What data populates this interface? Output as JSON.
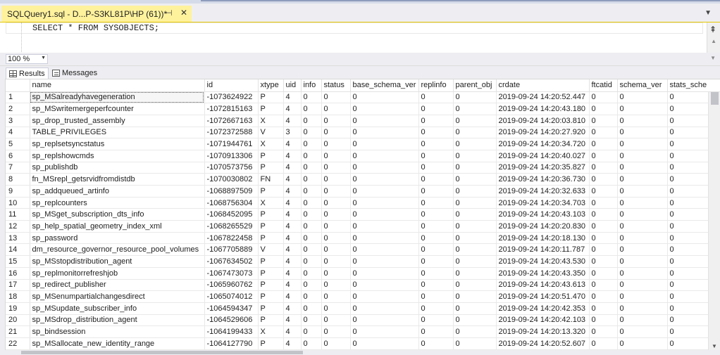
{
  "tab": {
    "title": "SQLQuery1.sql - D...P-S3KL81P\\HP (61))*",
    "pin_glyph": "⊣",
    "close_glyph": "✕",
    "dropdown_glyph": "▼"
  },
  "editor": {
    "code": "SELECT * FROM SYSOBJECTS;",
    "split_glyph": "⇞",
    "scroll_up_glyph": "▲"
  },
  "zoom": {
    "value": "100 %",
    "arrow_glyph": "▼",
    "scroll_down_glyph": "▼"
  },
  "result_tabs": {
    "results_label": "Results",
    "messages_label": "Messages"
  },
  "grid": {
    "columns": [
      "name",
      "id",
      "xtype",
      "uid",
      "info",
      "status",
      "base_schema_ver",
      "replinfo",
      "parent_obj",
      "crdate",
      "ftcatid",
      "schema_ver",
      "stats_sche"
    ],
    "rows": [
      [
        "1",
        "sp_MSalreadyhavegeneration",
        "-1073624922",
        "P",
        "4",
        "0",
        "0",
        "0",
        "0",
        "0",
        "2019-09-24 14:20:52.447",
        "0",
        "0",
        "0"
      ],
      [
        "2",
        "sp_MSwritemergeperfcounter",
        "-1072815163",
        "P",
        "4",
        "0",
        "0",
        "0",
        "0",
        "0",
        "2019-09-24 14:20:43.180",
        "0",
        "0",
        "0"
      ],
      [
        "3",
        "sp_drop_trusted_assembly",
        "-1072667163",
        "X",
        "4",
        "0",
        "0",
        "0",
        "0",
        "0",
        "2019-09-24 14:20:03.810",
        "0",
        "0",
        "0"
      ],
      [
        "4",
        "TABLE_PRIVILEGES",
        "-1072372588",
        "V",
        "3",
        "0",
        "0",
        "0",
        "0",
        "0",
        "2019-09-24 14:20:27.920",
        "0",
        "0",
        "0"
      ],
      [
        "5",
        "sp_replsetsyncstatus",
        "-1071944761",
        "X",
        "4",
        "0",
        "0",
        "0",
        "0",
        "0",
        "2019-09-24 14:20:34.720",
        "0",
        "0",
        "0"
      ],
      [
        "6",
        "sp_replshowcmds",
        "-1070913306",
        "P",
        "4",
        "0",
        "0",
        "0",
        "0",
        "0",
        "2019-09-24 14:20:40.027",
        "0",
        "0",
        "0"
      ],
      [
        "7",
        "sp_publishdb",
        "-1070573756",
        "P",
        "4",
        "0",
        "0",
        "0",
        "0",
        "0",
        "2019-09-24 14:20:35.827",
        "0",
        "0",
        "0"
      ],
      [
        "8",
        "fn_MSrepl_getsrvidfromdistdb",
        "-1070030802",
        "FN",
        "4",
        "0",
        "0",
        "0",
        "0",
        "0",
        "2019-09-24 14:20:36.730",
        "0",
        "0",
        "0"
      ],
      [
        "9",
        "sp_addqueued_artinfo",
        "-1068897509",
        "P",
        "4",
        "0",
        "0",
        "0",
        "0",
        "0",
        "2019-09-24 14:20:32.633",
        "0",
        "0",
        "0"
      ],
      [
        "10",
        "sp_replcounters",
        "-1068756304",
        "X",
        "4",
        "0",
        "0",
        "0",
        "0",
        "0",
        "2019-09-24 14:20:34.703",
        "0",
        "0",
        "0"
      ],
      [
        "11",
        "sp_MSget_subscription_dts_info",
        "-1068452095",
        "P",
        "4",
        "0",
        "0",
        "0",
        "0",
        "0",
        "2019-09-24 14:20:43.103",
        "0",
        "0",
        "0"
      ],
      [
        "12",
        "sp_help_spatial_geometry_index_xml",
        "-1068265529",
        "P",
        "4",
        "0",
        "0",
        "0",
        "0",
        "0",
        "2019-09-24 14:20:20.830",
        "0",
        "0",
        "0"
      ],
      [
        "13",
        "sp_password",
        "-1067822458",
        "P",
        "4",
        "0",
        "0",
        "0",
        "0",
        "0",
        "2019-09-24 14:20:18.130",
        "0",
        "0",
        "0"
      ],
      [
        "14",
        "dm_resource_governor_resource_pool_volumes",
        "-1067705889",
        "V",
        "4",
        "0",
        "0",
        "0",
        "0",
        "0",
        "2019-09-24 14:20:11.787",
        "0",
        "0",
        "0"
      ],
      [
        "15",
        "sp_MSstopdistribution_agent",
        "-1067634502",
        "P",
        "4",
        "0",
        "0",
        "0",
        "0",
        "0",
        "2019-09-24 14:20:43.530",
        "0",
        "0",
        "0"
      ],
      [
        "16",
        "sp_replmonitorrefreshjob",
        "-1067473073",
        "P",
        "4",
        "0",
        "0",
        "0",
        "0",
        "0",
        "2019-09-24 14:20:43.350",
        "0",
        "0",
        "0"
      ],
      [
        "17",
        "sp_redirect_publisher",
        "-1065960762",
        "P",
        "4",
        "0",
        "0",
        "0",
        "0",
        "0",
        "2019-09-24 14:20:43.613",
        "0",
        "0",
        "0"
      ],
      [
        "18",
        "sp_MSenumpartialchangesdirect",
        "-1065074012",
        "P",
        "4",
        "0",
        "0",
        "0",
        "0",
        "0",
        "2019-09-24 14:20:51.470",
        "0",
        "0",
        "0"
      ],
      [
        "19",
        "sp_MSupdate_subscriber_info",
        "-1064594347",
        "P",
        "4",
        "0",
        "0",
        "0",
        "0",
        "0",
        "2019-09-24 14:20:42.353",
        "0",
        "0",
        "0"
      ],
      [
        "20",
        "sp_MSdrop_distribution_agent",
        "-1064529606",
        "P",
        "4",
        "0",
        "0",
        "0",
        "0",
        "0",
        "2019-09-24 14:20:42.103",
        "0",
        "0",
        "0"
      ],
      [
        "21",
        "sp_bindsession",
        "-1064199433",
        "X",
        "4",
        "0",
        "0",
        "0",
        "0",
        "0",
        "2019-09-24 14:20:13.320",
        "0",
        "0",
        "0"
      ],
      [
        "22",
        "sp_MSallocate_new_identity_range",
        "-1064127790",
        "P",
        "4",
        "0",
        "0",
        "0",
        "0",
        "0",
        "2019-09-24 14:20:52.607",
        "0",
        "0",
        "0"
      ]
    ],
    "selected_row": 0,
    "scroll_down_glyph": "▼"
  },
  "colors": {
    "tab_active": "#fff29d",
    "chrome": "#eeeef2",
    "grid_bg": "#ffffff"
  }
}
